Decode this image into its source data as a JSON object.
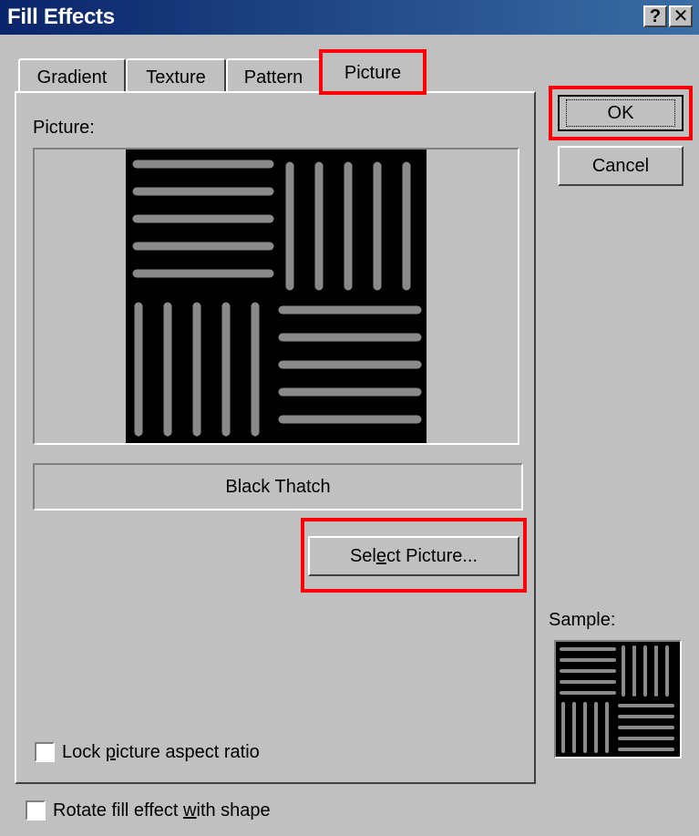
{
  "window": {
    "title": "Fill Effects",
    "help_button": "?",
    "close_button": "✕"
  },
  "tabs": [
    {
      "label": "Gradient"
    },
    {
      "label": "Texture"
    },
    {
      "label": "Pattern"
    },
    {
      "label": "Picture",
      "active": true
    }
  ],
  "picture_tab": {
    "picture_label": "Picture:",
    "picture_name": "Black Thatch",
    "select_button": {
      "before": "Sel",
      "accel": "e",
      "after": "ct Picture..."
    },
    "lock_checkbox": {
      "before": "Lock ",
      "accel": "p",
      "after": "icture aspect ratio",
      "checked": false
    }
  },
  "buttons": {
    "ok": "OK",
    "cancel": "Cancel"
  },
  "sample_label": "Sample:",
  "rotate_checkbox": {
    "before": "Rotate fill effect ",
    "accel": "w",
    "after": "ith shape",
    "checked": false
  },
  "highlight_color": "#ff0000",
  "title_bar_color": "#0a246a"
}
